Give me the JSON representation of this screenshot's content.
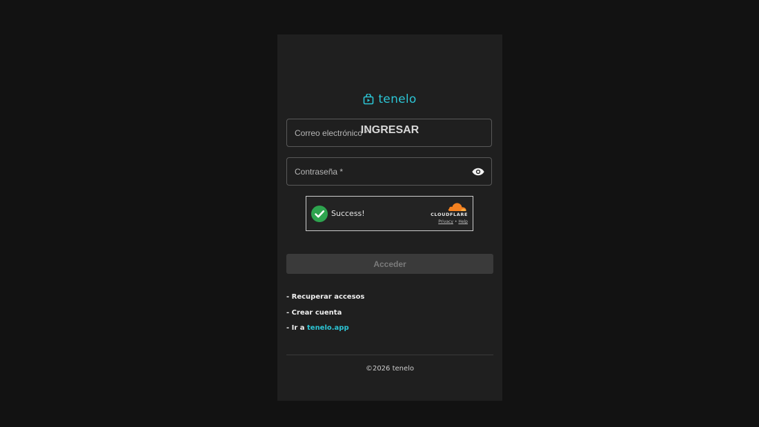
{
  "brand": {
    "name": "tenelo",
    "accent_color": "#2cc6d6",
    "icon": "shopping-bag-play-icon"
  },
  "login": {
    "title": "INGRESAR",
    "email_placeholder": "Correo electrónico *",
    "password_placeholder": "Contraseña *",
    "toggle_password_icon": "eye-icon",
    "submit_label": "Acceder"
  },
  "captcha": {
    "status_text": "Success!",
    "status_icon": "check-circle-icon",
    "status_color": "#2ea44f",
    "provider": "CLOUDFLARE",
    "provider_color": "#f48120",
    "privacy_label": "Privacy",
    "separator": "•",
    "help_label": "Help"
  },
  "links": {
    "recover_label": "- Recuperar accesos",
    "create_label": "- Crear cuenta",
    "goto_prefix": "- Ir a ",
    "goto_link": "tenelo.app"
  },
  "footer": {
    "copyright": "©2026 tenelo"
  }
}
